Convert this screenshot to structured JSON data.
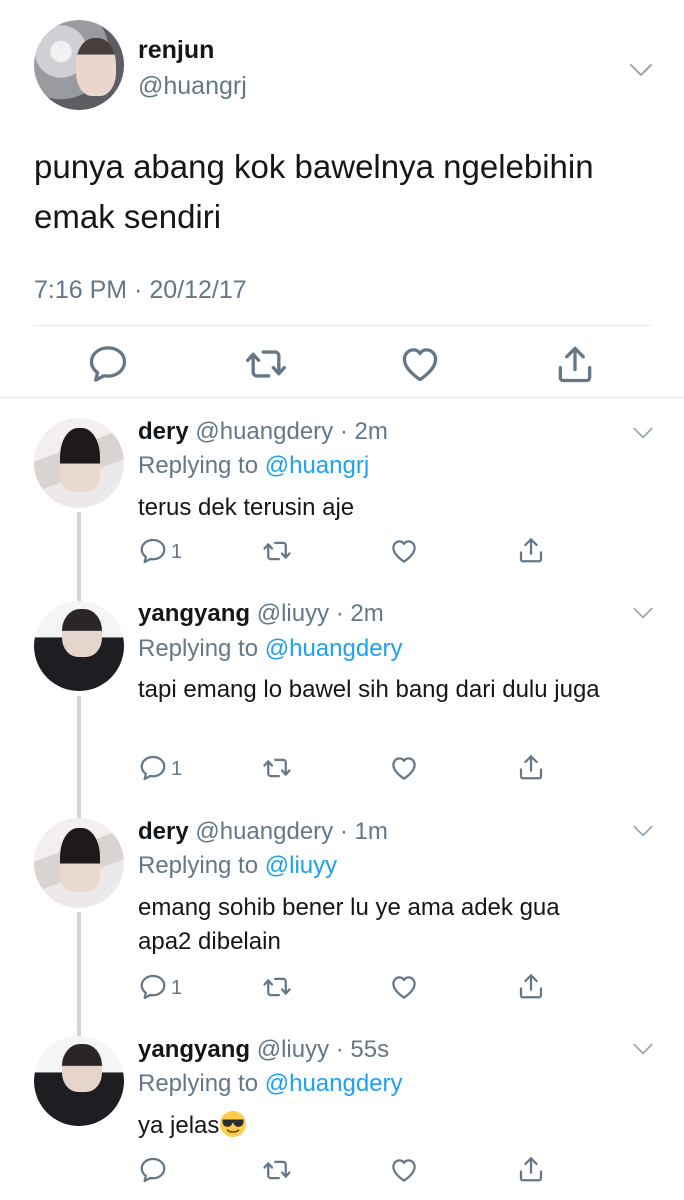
{
  "main_tweet": {
    "name": "renjun",
    "handle": "@huangrj",
    "text": "punya abang kok bawelnya ngelebihin emak sendiri",
    "timestamp": "7:16 PM · 20/12/17"
  },
  "replies": [
    {
      "name": "dery",
      "handle": "@huangdery",
      "time": "· 2m",
      "replying_prefix": "Replying to ",
      "replying_to": "@huangrj",
      "text": "terus dek terusin aje",
      "reply_count": "1"
    },
    {
      "name": "yangyang",
      "handle": "@liuyy",
      "time": "· 2m",
      "replying_prefix": "Replying to ",
      "replying_to": "@huangdery",
      "text": "tapi emang lo bawel sih bang dari dulu juga",
      "reply_count": "1"
    },
    {
      "name": "dery",
      "handle": "@huangdery",
      "time": "· 1m",
      "replying_prefix": "Replying to ",
      "replying_to": "@liuyy",
      "text": "emang sohib bener lu ye ama adek gua apa2 dibelain",
      "reply_count": "1"
    },
    {
      "name": "yangyang",
      "handle": "@liuyy",
      "time": "· 55s",
      "replying_prefix": "Replying to ",
      "replying_to": "@huangdery",
      "text": "ya jelas",
      "emoji": "smiling-face-with-sunglasses-emoji",
      "reply_count": ""
    }
  ],
  "icons": {
    "reply": "reply-icon",
    "retweet": "retweet-icon",
    "like": "like-icon",
    "share": "share-icon",
    "more": "chevron-down-icon"
  },
  "colors": {
    "text": "#14171a",
    "secondary": "#657786",
    "link": "#1da1f2",
    "divider": "#e6ecf0",
    "thread_line": "#ccd6dd"
  }
}
